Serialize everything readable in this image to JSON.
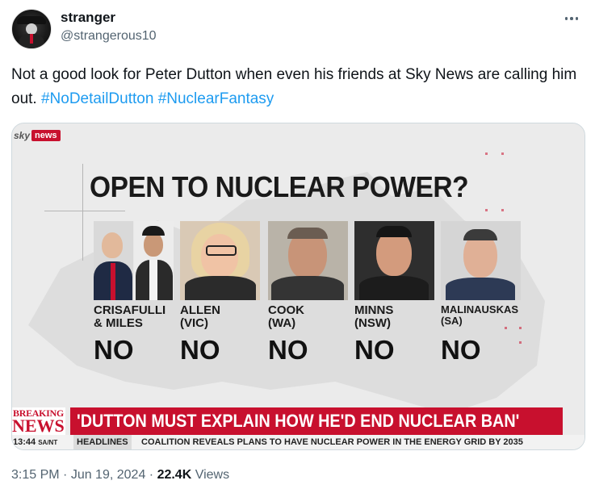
{
  "author": {
    "display_name": "stranger",
    "handle": "@strangerous10"
  },
  "tweet": {
    "text_before": "Not a good look for Peter Dutton when even his friends at Sky News are calling him out. ",
    "hashtags": [
      "#NoDetailDutton",
      "#NuclearFantasy"
    ]
  },
  "media": {
    "logo_sky": "sky",
    "logo_news": "news",
    "headline": "OPEN TO NUCLEAR POWER?",
    "people": [
      {
        "name_line1": "CRISAFULLI",
        "name_line2": "& MILES",
        "verdict": "NO"
      },
      {
        "name_line1": "ALLEN",
        "name_line2": "(VIC)",
        "verdict": "NO"
      },
      {
        "name_line1": "COOK",
        "name_line2": "(WA)",
        "verdict": "NO"
      },
      {
        "name_line1": "MINNS",
        "name_line2": "(NSW)",
        "verdict": "NO"
      },
      {
        "name_line1": "MALINAUSKAS",
        "name_line2": "(SA)",
        "verdict": "NO"
      }
    ],
    "breaking_line1": "BREAKING",
    "breaking_line2": "NEWS",
    "breaking_headline": "'DUTTON MUST EXPLAIN HOW HE'D END NUCLEAR BAN'",
    "ticker_time": "13:44",
    "ticker_zone": "SA/NT",
    "ticker_label": "HEADLINES",
    "ticker_text": "COALITION REVEALS PLANS TO HAVE NUCLEAR POWER IN THE ENERGY GRID BY 2035"
  },
  "meta": {
    "time": "3:15 PM",
    "sep1": " · ",
    "date": "Jun 19, 2024",
    "sep2": " · ",
    "views_count": "22.4K",
    "views_label": " Views"
  },
  "colors": {
    "link": "#1d9bf0",
    "sky_red": "#c8102e",
    "muted": "#536471"
  },
  "icons": {
    "more": "more-dots-icon",
    "avatar": "avatar-image"
  }
}
